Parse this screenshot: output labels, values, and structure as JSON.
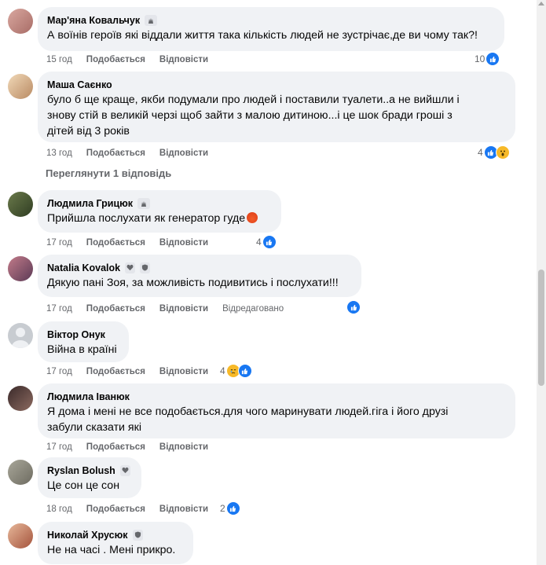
{
  "actions": {
    "like": "Подобається",
    "reply": "Відповісти",
    "edited": "Відредаговано"
  },
  "view_replies": "Переглянути 1 відповідь",
  "colors": {
    "bubble": "#f0f2f5",
    "like_blue": "#1877f2",
    "meta_gray": "#65676b"
  },
  "comments": [
    {
      "author": "Мар'яна Ковальчук",
      "badge": "fan-icon",
      "text": [
        "А воїнів героїв які віддали життя така кількість людей не зустрічає,де ви чому так?!"
      ],
      "time": "15 год",
      "reactions_count": "10",
      "reactions": [
        "like"
      ]
    },
    {
      "author": "Маша Саєнко",
      "badge": "",
      "text": [
        "було б ще краще, якби подумали про людей і поставили туалети..а не вийшли і",
        "знову стій в великій черзі щоб зайти з малою дитиною...і це шок бради гроші з",
        "дітей від 3 років"
      ],
      "time": "13 год",
      "reactions_count": "4",
      "reactions": [
        "like",
        "wow"
      ]
    },
    {
      "author": "Людмила Грицюк",
      "badge": "fan-icon",
      "text": [
        "Прийшла послухати як генератор гуде"
      ],
      "time": "17 год",
      "reactions_count": "4",
      "reactions": [
        "like"
      ]
    },
    {
      "author": "Natalia Kovalok",
      "badge": "heart-badge-icon",
      "text": [
        "Дякую пані Зоя, за можливість подивитись і послухати!!!"
      ],
      "time": "17 год",
      "reactions_count": "",
      "reactions": [
        "like"
      ]
    },
    {
      "author": "Віктор Онук",
      "badge": "",
      "text": [
        "Війна в країні"
      ],
      "time": "17 год",
      "reactions_count": "4",
      "reactions": [
        "sad",
        "like"
      ]
    },
    {
      "author": "Людмила Іванюк",
      "badge": "",
      "text": [
        "Я дома і мені не все подобається.для чого маринувати людей.гіга і його друзі",
        "забули сказати які"
      ],
      "time": "17 год",
      "reactions_count": "",
      "reactions": []
    },
    {
      "author": "Ryslan Bolush",
      "badge": "heart-badge-icon",
      "text": [
        "Це сон це сон"
      ],
      "time": "18 год",
      "reactions_count": "2",
      "reactions": [
        "like"
      ]
    },
    {
      "author": "Николай Хрусюк",
      "badge": "shield-badge-icon",
      "text": [
        "Не на часі . Мені прикро."
      ],
      "time": "",
      "reactions_count": "",
      "reactions": []
    }
  ]
}
